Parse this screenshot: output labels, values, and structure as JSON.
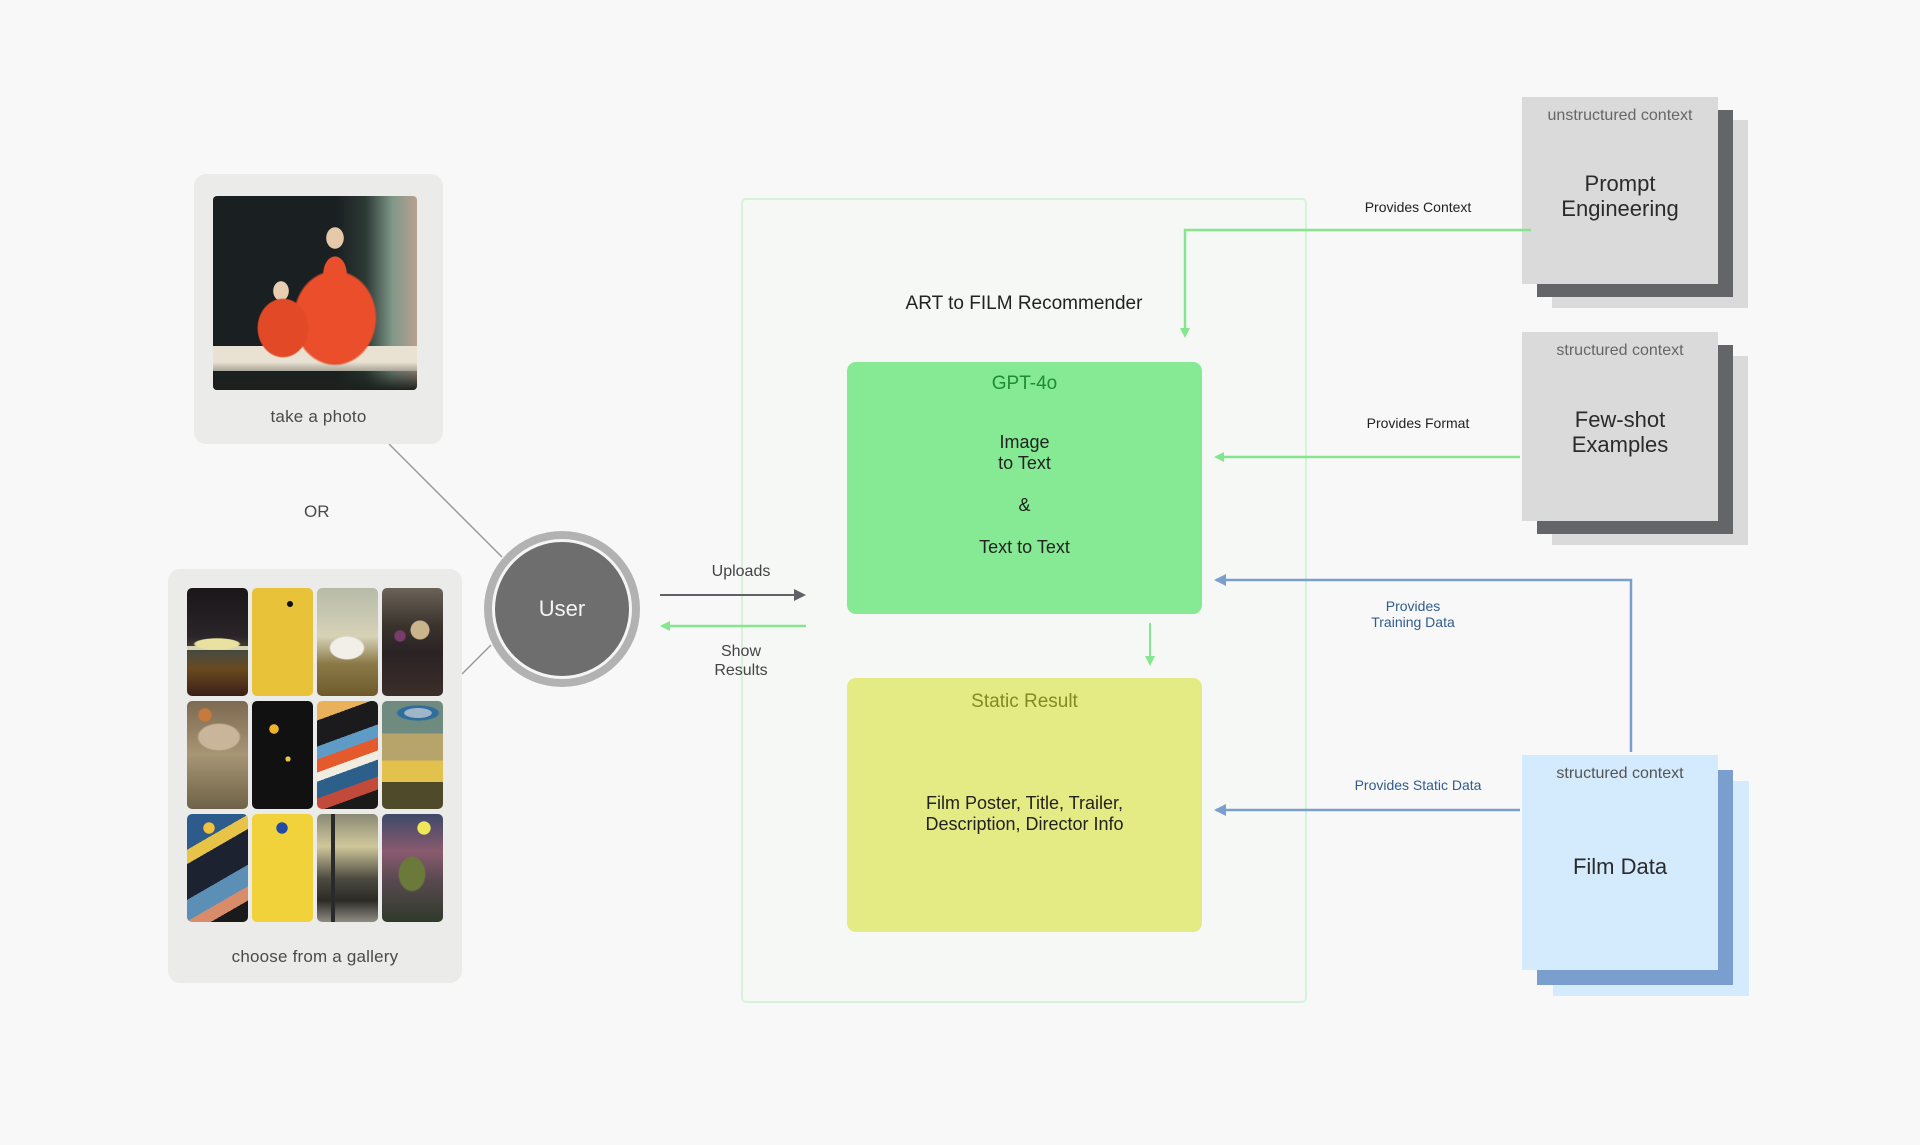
{
  "diagram": {
    "title": "ART to FILM Recommender"
  },
  "inputs": {
    "photo": {
      "label": "take a photo",
      "image": "folk-portrait-two-children-red-dresses"
    },
    "or_label": "OR",
    "gallery": {
      "label": "choose from a gallery",
      "tiles": [
        {
          "subject": "ufo-over-field"
        },
        {
          "subject": "abstract-cubist-eyes"
        },
        {
          "subject": "dalmatian-dog"
        },
        {
          "subject": "skull-still-life"
        },
        {
          "subject": "lion-fresco"
        },
        {
          "subject": "cosmic-abstract-dots"
        },
        {
          "subject": "swirling-ribbon-abstract"
        },
        {
          "subject": "saturn-over-boats"
        },
        {
          "subject": "picasso-style-figures"
        },
        {
          "subject": "matisse-ant-collage"
        },
        {
          "subject": "eiffel-tower-storm"
        },
        {
          "subject": "venus-flytrap-sun"
        }
      ]
    }
  },
  "user": {
    "label": "User"
  },
  "flows": {
    "uploads": "Uploads",
    "show_results_line1": "Show",
    "show_results_line2": "Results"
  },
  "gpt": {
    "title": "GPT-4o",
    "lines": [
      "Image",
      "to Text",
      "",
      "&",
      "",
      "Text to Text"
    ]
  },
  "static_result": {
    "title": "Static Result",
    "line1": "Film Poster, Title, Trailer,",
    "line2": "Description, Director Info"
  },
  "contexts": [
    {
      "kind": "unstructured context",
      "title_line1": "Prompt",
      "title_line2": "Engineering",
      "edge_label": "Provides Context",
      "colors": {
        "front": "#dadada",
        "mid": "#636569",
        "back": "#dadada"
      }
    },
    {
      "kind": "structured context",
      "title_line1": "Few-shot",
      "title_line2": "Examples",
      "edge_label": "Provides Format",
      "colors": {
        "front": "#dadada",
        "mid": "#636569",
        "back": "#dadada"
      }
    },
    {
      "kind": "structured context",
      "title_line1": "Film Data",
      "title_line2": "",
      "edge_label_training_line1": "Provides",
      "edge_label_training_line2": "Training Data",
      "edge_label": "Provides Static Data",
      "colors": {
        "front": "#d4eafd",
        "mid": "#7a9ecd",
        "back": "#d4eafd"
      }
    }
  ],
  "colors": {
    "background": "#f8f8f8",
    "green_arrow": "#86e58f",
    "blue_arrow": "#7a9ecd",
    "gray_arrow": "#5f6166",
    "gpt_fill": "#86e994",
    "static_fill": "#e4ea84",
    "container_border": "#d7f2da"
  }
}
